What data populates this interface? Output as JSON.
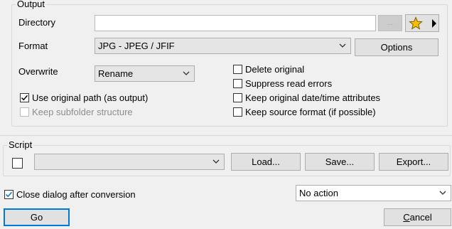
{
  "output": {
    "group_title": "Output",
    "directory_label": "Directory",
    "directory_value": "",
    "browse_label": "...",
    "format_label": "Format",
    "format_value": "JPG - JPEG / JFIF",
    "options_label": "Options",
    "overwrite_label": "Overwrite",
    "overwrite_value": "Rename",
    "use_original_path_label": "Use original path (as output)",
    "use_original_path_checked": true,
    "keep_subfolder_label": "Keep subfolder structure",
    "keep_subfolder_checked": false,
    "delete_original_label": "Delete original",
    "suppress_errors_label": "Suppress read errors",
    "keep_date_label": "Keep original date/time attributes",
    "keep_format_label": "Keep source format (if possible)"
  },
  "script": {
    "group_title": "Script",
    "script_value": "",
    "load_label": "Load...",
    "save_label": "Save...",
    "export_label": "Export..."
  },
  "footer": {
    "close_dialog_label": "Close dialog after conversion",
    "close_dialog_checked": true,
    "after_action_value": "No action",
    "go_label": "Go",
    "cancel_label_pre": "",
    "cancel_label_u": "C",
    "cancel_label_post": "ancel"
  },
  "icons": {
    "favorites": "star-icon",
    "menu": "triangle-right-icon",
    "dropdown": "chevron-down-icon",
    "check": "checkmark-icon"
  },
  "colors": {
    "accent": "#0078d7",
    "star": "#f5c000"
  }
}
